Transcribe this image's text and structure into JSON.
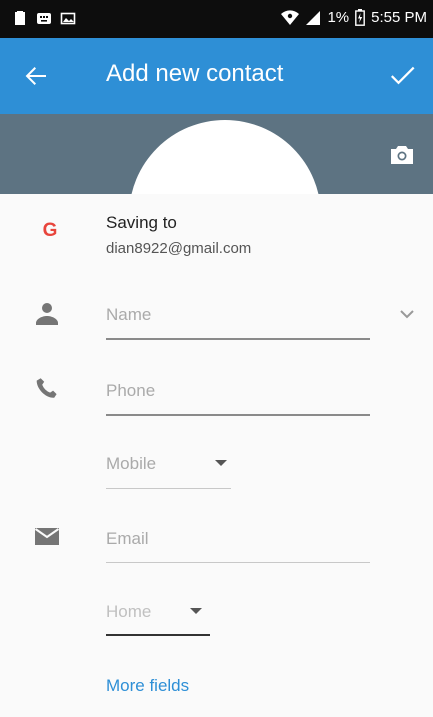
{
  "status_bar": {
    "battery_percent": "1%",
    "time": "5:55 PM",
    "icons": [
      "notification-icon",
      "keyboard-icon",
      "image-icon",
      "wifi-icon",
      "signal-icon",
      "battery-icon"
    ]
  },
  "app_bar": {
    "title": "Add new contact",
    "back_icon": "arrow-back-icon",
    "save_icon": "check-icon",
    "background": "#2e8fd6"
  },
  "photo": {
    "camera_icon": "camera-icon",
    "background": "#5d7382"
  },
  "account": {
    "logo_letter": "G",
    "title": "Saving to",
    "email": "dian8922@gmail.com"
  },
  "fields": {
    "name_placeholder": "Name",
    "phone_placeholder": "Phone",
    "phone_type": "Mobile",
    "email_placeholder": "Email",
    "email_type": "Home"
  },
  "more_fields_label": "More fields",
  "colors": {
    "accent": "#2e8fd6",
    "icon_gray": "#757575"
  }
}
